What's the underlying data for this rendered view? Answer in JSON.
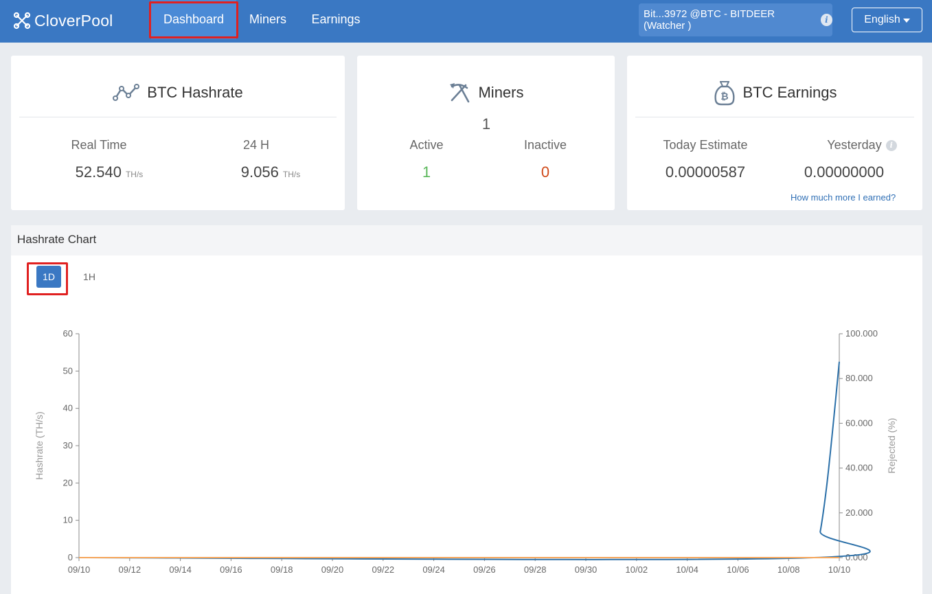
{
  "nav": {
    "logo_text": "CloverPool",
    "items": [
      "Dashboard",
      "Miners",
      "Earnings"
    ],
    "account": "Bit...3972 @BTC - BITDEER (Watcher )",
    "info": "i",
    "language": "English"
  },
  "hashrate_card": {
    "title": "BTC Hashrate",
    "realtime_label": "Real Time",
    "realtime_value": "52.540",
    "h24_label": "24 H",
    "h24_value": "9.056",
    "unit": "TH/s"
  },
  "miners_card": {
    "title": "Miners",
    "total": "1",
    "active_label": "Active",
    "active_value": "1",
    "inactive_label": "Inactive",
    "inactive_value": "0"
  },
  "earnings_card": {
    "title": "BTC Earnings",
    "today_label": "Today Estimate",
    "today_value": "0.00000587",
    "yesterday_label": "Yesterday",
    "yesterday_value": "0.00000000",
    "link": "How much more I earned?"
  },
  "chart_panel": {
    "title": "Hashrate Chart",
    "ranges": [
      "1D",
      "1H"
    ],
    "active_range": "1D"
  },
  "colors": {
    "nav": "#3a78c3",
    "active_green": "#5cb85c",
    "inactive_red": "#d04a1a",
    "hashrate_line": "#2a6fa8",
    "rejected_line": "#f5a55a"
  },
  "chart_data": {
    "type": "line",
    "x": [
      "09/10",
      "09/12",
      "09/14",
      "09/16",
      "09/18",
      "09/20",
      "09/22",
      "09/24",
      "09/26",
      "09/28",
      "09/30",
      "10/02",
      "10/04",
      "10/06",
      "10/08",
      "10/10"
    ],
    "xlabel": "",
    "ylabel": "Hashrate (TH/s)",
    "ylim": [
      0,
      60
    ],
    "yticks": [
      "0",
      "10",
      "20",
      "30",
      "40",
      "50",
      "60"
    ],
    "y2label": "Rejected (%)",
    "y2lim": [
      0,
      100
    ],
    "y2ticks": [
      "0.000",
      "20.000",
      "40.000",
      "60.000",
      "80.000",
      "100.000"
    ],
    "series": [
      {
        "axis": "left",
        "points": [
          {
            "x": "09/10",
            "y": 0
          },
          {
            "x": "10/09",
            "y": 0
          },
          {
            "x": "10/09 06:00",
            "y": 7
          },
          {
            "x": "10/09 12:00",
            "y": 19
          },
          {
            "x": "10/09 18:00",
            "y": 35
          },
          {
            "x": "10/10",
            "y": 52.5
          }
        ]
      },
      {
        "axis": "right",
        "points": [
          {
            "x": "09/10",
            "y": 0
          },
          {
            "x": "10/10",
            "y": 0
          }
        ]
      }
    ]
  }
}
